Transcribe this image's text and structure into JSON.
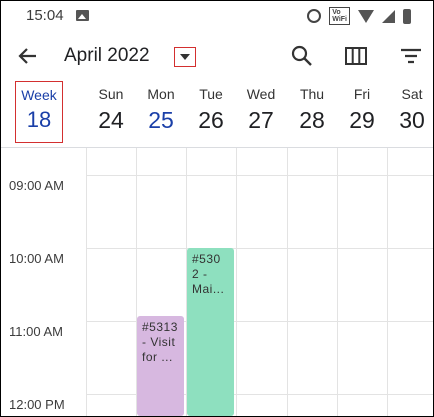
{
  "status_bar": {
    "time": "15:04",
    "icons": [
      "image-icon",
      "alarm-icon",
      "volte-wifi-icon",
      "wifi-icon",
      "signal-icon",
      "battery-icon"
    ],
    "volte_text": "Vo\nWiFi"
  },
  "toolbar": {
    "back_icon": "back-arrow-icon",
    "month_title": "April 2022",
    "dropdown_icon": "dropdown-icon",
    "actions": [
      "search-icon",
      "columns-view-icon",
      "filter-icon"
    ]
  },
  "week": {
    "label": "Week",
    "number": "18",
    "days": [
      {
        "name": "Sun",
        "num": "24"
      },
      {
        "name": "Mon",
        "num": "25",
        "today": true
      },
      {
        "name": "Tue",
        "num": "26"
      },
      {
        "name": "Wed",
        "num": "27"
      },
      {
        "name": "Thu",
        "num": "28"
      },
      {
        "name": "Fri",
        "num": "29"
      },
      {
        "name": "Sat",
        "num": "30"
      }
    ]
  },
  "timeline": {
    "labels": [
      "09:00 AM",
      "10:00 AM",
      "11:00 AM",
      "12:00 PM"
    ]
  },
  "events": [
    {
      "text": "#530\n2 -\nMai...",
      "color": "#8ee0bf",
      "day": "Tue"
    },
    {
      "text": "#5313\n- Visit\nfor ...",
      "color": "#d7b8e0",
      "day": "Mon"
    }
  ],
  "colors": {
    "accent": "#1a3fa8",
    "highlight_border": "#d32f2f"
  }
}
